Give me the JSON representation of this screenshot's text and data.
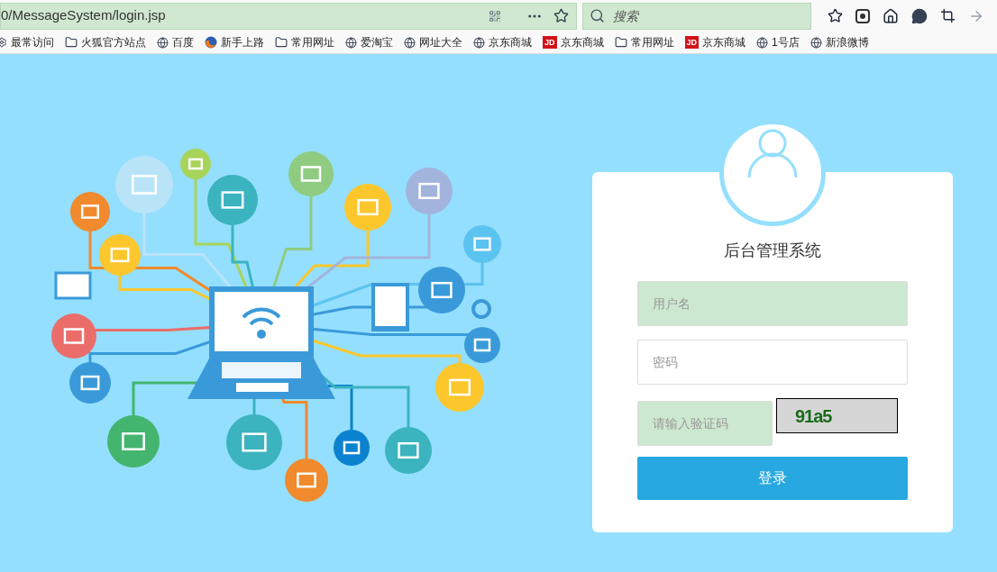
{
  "browser": {
    "url": "0/MessageSystem/login.jsp",
    "search": {
      "placeholder": "搜索"
    }
  },
  "bookmarks": [
    {
      "label": "最常访问",
      "kind": "gear"
    },
    {
      "label": "火狐官方站点",
      "kind": "folder"
    },
    {
      "label": "百度",
      "kind": "globe"
    },
    {
      "label": "新手上路",
      "kind": "firefox"
    },
    {
      "label": "常用网址",
      "kind": "folder"
    },
    {
      "label": "爱淘宝",
      "kind": "globe"
    },
    {
      "label": "网址大全",
      "kind": "globe"
    },
    {
      "label": "京东商城",
      "kind": "globe"
    },
    {
      "label": "京东商城",
      "kind": "jd",
      "badge": "JD"
    },
    {
      "label": "常用网址",
      "kind": "folder"
    },
    {
      "label": "京东商城",
      "kind": "jd",
      "badge": "JD"
    },
    {
      "label": "1号店",
      "kind": "globe"
    },
    {
      "label": "新浪微博",
      "kind": "globe"
    }
  ],
  "login": {
    "title": "后台管理系统",
    "username": {
      "placeholder": "用户名"
    },
    "password": {
      "placeholder": "密码"
    },
    "captcha": {
      "placeholder": "请输入验证码",
      "code": "91a5"
    },
    "submit": "登录"
  }
}
